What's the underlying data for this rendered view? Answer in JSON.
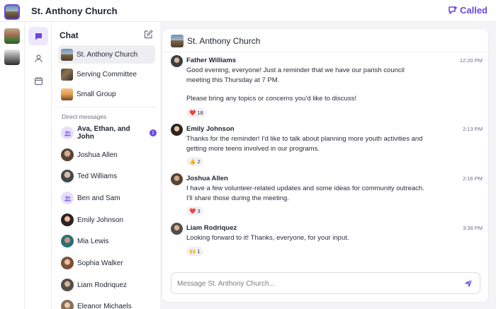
{
  "app": {
    "title": "St. Anthony Church",
    "brand": "Called",
    "accent": "#6b46e5"
  },
  "icons": {
    "brand": "chat-bubble-plus-icon",
    "nav_chat": "chat-bubble-icon",
    "nav_people": "person-icon",
    "nav_calendar": "calendar-icon",
    "compose": "compose-icon",
    "send": "send-icon"
  },
  "chat_list": {
    "header": "Chat",
    "channels": [
      {
        "label": "St. Anthony Church",
        "active": true
      },
      {
        "label": "Serving Committee",
        "active": false
      },
      {
        "label": "Small Group",
        "active": false
      }
    ],
    "dm_header": "Direct messages",
    "direct_messages": [
      {
        "label": "Ava, Ethan, and John",
        "badge": "1",
        "group": true
      },
      {
        "label": "Joshua Allen"
      },
      {
        "label": "Ted Williams"
      },
      {
        "label": "Ben and Sam",
        "group": true
      },
      {
        "label": "Emily Johnson"
      },
      {
        "label": "Mia Lewis"
      },
      {
        "label": "Sophia Walker"
      },
      {
        "label": "Liam Rodriquez"
      },
      {
        "label": "Eleanor Michaels"
      }
    ]
  },
  "conversation": {
    "title": "St. Anthony Church",
    "messages": [
      {
        "author": "Father Williams",
        "time": "12:20 PM",
        "lines": [
          "Good evening, everyone! Just a reminder that we have our parish council meeting this Thursday at 7 PM.",
          "Please bring any topics or concerns you'd like to discuss!"
        ],
        "reaction": {
          "emoji": "❤️",
          "count": "18"
        }
      },
      {
        "author": "Emily Johnson",
        "time": "2:13 PM",
        "lines": [
          "Thanks for the reminder! I'd like to talk about planning more youth activities and getting more teens involved in our programs."
        ],
        "reaction": {
          "emoji": "👍",
          "count": "2"
        }
      },
      {
        "author": "Joshua Allen",
        "time": "2:16 PM",
        "lines": [
          "I have a few volunteer-related updates and some ideas for community outreach. I'll share those during the meeting."
        ],
        "reaction": {
          "emoji": "❤️",
          "count": "3"
        }
      },
      {
        "author": "Liam Rodriquez",
        "time": "3:39 PM",
        "lines": [
          "Looking forward to it! Thanks, everyone, for your input."
        ],
        "reaction": {
          "emoji": "🙌",
          "count": "1"
        }
      }
    ],
    "composer_placeholder": "Message St. Anthony Church..."
  }
}
